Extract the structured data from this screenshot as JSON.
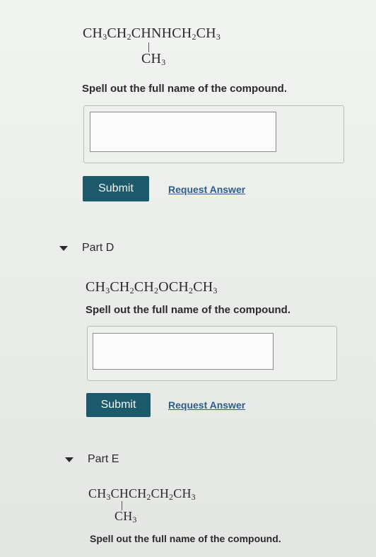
{
  "part_c": {
    "formula_main_parts": [
      "CH",
      "3",
      "CH",
      "2",
      "CHNHCH",
      "2",
      "CH",
      "3"
    ],
    "formula_branch_parts": [
      "CH",
      "3"
    ],
    "prompt": "Spell out the full name of the compound.",
    "input_value": "",
    "submit_label": "Submit",
    "request_label": "Request Answer"
  },
  "part_d": {
    "title": "Part D",
    "formula_main_parts": [
      "CH",
      "3",
      "CH",
      "2",
      "CH",
      "2",
      "OCH",
      "2",
      "CH",
      "3"
    ],
    "prompt": "Spell out the full name of the compound.",
    "input_value": "",
    "submit_label": "Submit",
    "request_label": "Request Answer"
  },
  "part_e": {
    "title": "Part E",
    "formula_main_parts": [
      "CH",
      "3",
      "CHCH",
      "2",
      "CH",
      "2",
      "CH",
      "3"
    ],
    "formula_branch_parts": [
      "CH",
      "3"
    ],
    "prompt": "Spell out the full name of the compound."
  },
  "icons": {
    "collapse_caret": "caret-down-icon"
  }
}
